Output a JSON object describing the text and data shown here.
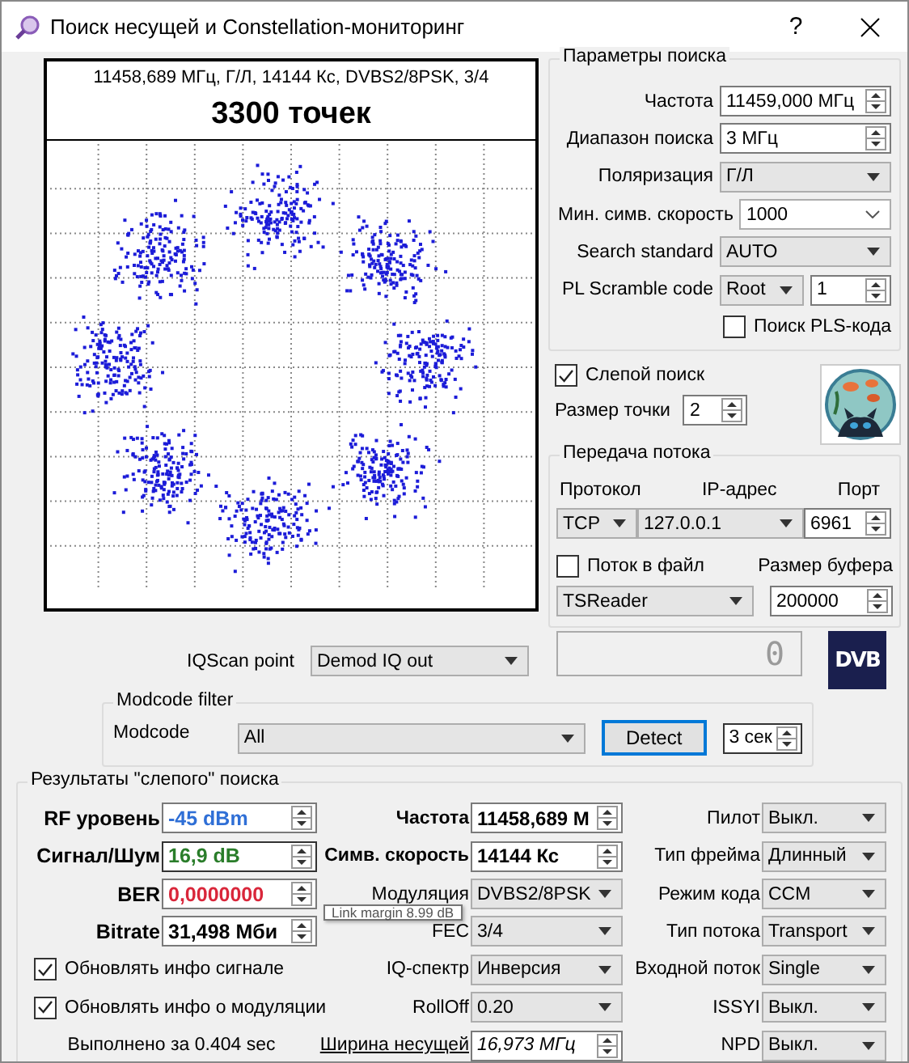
{
  "window": {
    "title": "Поиск несущей и Constellation-мониторинг",
    "help": "?"
  },
  "constellation": {
    "info": "11458,689 МГц, Г/Л, 14144 Кс, DVBS2/8PSK, 3/4",
    "points": "3300 точек"
  },
  "search_params": {
    "title": "Параметры поиска",
    "rows": [
      {
        "label": "Частота",
        "kind": "spin",
        "value": "11459,000 МГц"
      },
      {
        "label": "Диапазон поиска",
        "kind": "spin",
        "value": "3 МГц"
      },
      {
        "label": "Поляризация",
        "kind": "select",
        "value": "Г/Л"
      },
      {
        "label": "Мин. симв. скорость",
        "kind": "combo",
        "value": "1000"
      },
      {
        "label": "Search standard",
        "kind": "select",
        "value": "AUTO"
      },
      {
        "label": "PL Scramble code",
        "kind": "select_spin",
        "value": "Root",
        "value2": "1"
      }
    ],
    "pls_search": {
      "label": "Поиск PLS-кода",
      "checked": false
    }
  },
  "blind_search": {
    "label": "Слепой поиск",
    "checked": true
  },
  "dot_size": {
    "label": "Размер точки",
    "value": "2"
  },
  "stream": {
    "title": "Передача потока",
    "protocol_label": "Протокол",
    "ip_label": "IP-адрес",
    "port_label": "Порт",
    "protocol": "TCP",
    "ip": "127.0.0.1",
    "port": "6961",
    "to_file": {
      "label": "Поток в файл",
      "checked": false
    },
    "buffer_label": "Размер буфера",
    "target": "TSReader",
    "buffer": "200000"
  },
  "iqscan": {
    "label": "IQScan point",
    "value": "Demod IQ out"
  },
  "lcd": "0",
  "dvb_logo": "DVB",
  "modcode_filter": {
    "title": "Modcode filter",
    "label": "Modcode",
    "value": "All",
    "detect": "Detect",
    "duration": "3 сек"
  },
  "results": {
    "title": "Результаты \"слепого\" поиска",
    "signal": [
      {
        "label": "RF уровень",
        "value": "-45 dBm",
        "color": "#2f6fd6"
      },
      {
        "label": "Сигнал/Шум",
        "value": "16,9 dB",
        "color": "#2a7d2a"
      },
      {
        "label": "BER",
        "value": "0,0000000",
        "color": "#d9263a"
      },
      {
        "label": "Bitrate",
        "value": "31,498 Мби",
        "color": "#000000"
      }
    ],
    "carrier": [
      {
        "label": "Частота",
        "kind": "spin",
        "value": "11458,689 М"
      },
      {
        "label": "Симв. скорость",
        "kind": "spin",
        "value": "14144 Кс"
      },
      {
        "label": "Модуляция",
        "kind": "select",
        "value": "DVBS2/8PSK"
      },
      {
        "label": "FEC",
        "kind": "select",
        "value": "3/4"
      },
      {
        "label": "IQ-спектр",
        "kind": "select",
        "value": "Инверсия"
      },
      {
        "label": "RollOff",
        "kind": "select",
        "value": "0.20"
      },
      {
        "label": "Ширина несущей",
        "kind": "link",
        "value": "16,973 МГц"
      }
    ],
    "frame": [
      {
        "label": "Пилот",
        "value": "Выкл."
      },
      {
        "label": "Тип фрейма",
        "value": "Длинный"
      },
      {
        "label": "Режим кода",
        "value": "CCM"
      },
      {
        "label": "Тип потока",
        "value": "Transport"
      },
      {
        "label": "Входной поток",
        "value": "Single"
      },
      {
        "label": "ISSYI",
        "value": "Выкл."
      },
      {
        "label": "NPD",
        "value": "Выкл."
      }
    ],
    "options": [
      {
        "label": "Обновлять инфо сигнале",
        "checked": true
      },
      {
        "label": "Обновлять инфо о модуляции",
        "checked": true
      }
    ],
    "elapsed": "Выполнено за 0.404 sec"
  },
  "tooltip": "Link margin 8.99 dB"
}
